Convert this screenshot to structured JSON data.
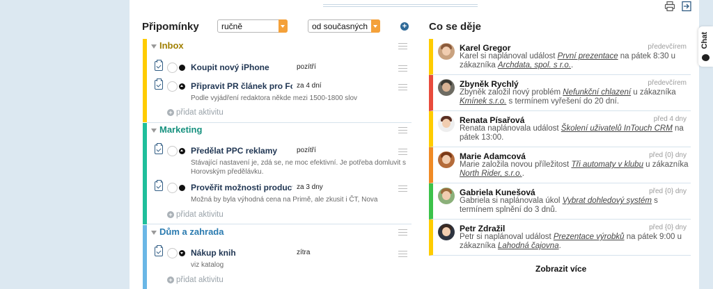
{
  "reminders": {
    "title": "Připomínky",
    "sort_select": "ručně",
    "filter_select": "od současných",
    "add_label": "+",
    "add_activity_label": "přidat aktivitu",
    "groups": [
      {
        "name": "Inbox",
        "color": "#ffcc00",
        "name_color": "#a07f00",
        "tasks": [
          {
            "name": "Koupit nový iPhone",
            "due": "pozítří",
            "desc": ""
          },
          {
            "name": "Připravit PR článek pro Food",
            "due": "za 4 dní",
            "desc": "Podle vyjádření redaktora někde mezi 1500-1800 slov"
          }
        ]
      },
      {
        "name": "Marketing",
        "color": "#1fbf9b",
        "name_color": "#17917f",
        "tasks": [
          {
            "name": "Předělat PPC reklamy",
            "due": "pozítří",
            "desc": "Stávající nastavení je, zdá se, ne moc efektivní. Je potřeba domluvit s Horovským předělávku."
          },
          {
            "name": "Prověřit možnosti product placementu",
            "due": "za 3 dny",
            "desc": "Možná by byla výhodná cena na Primě, ale zkusit i ČT, Nova"
          }
        ]
      },
      {
        "name": "Dům a zahrada",
        "color": "#6ab7e6",
        "name_color": "#2b7bb0",
        "tasks": [
          {
            "name": "Nákup knih",
            "due": "zítra",
            "desc": "viz katalog"
          }
        ]
      }
    ]
  },
  "feed": {
    "title": "Co se děje",
    "more_label": "Zobrazit více",
    "items": [
      {
        "color": "#ffcc00",
        "who": "Karel Gregor",
        "when": "předevčírem",
        "m1": "Karel si naplánoval událost ",
        "link1": "První prezentace",
        "m2": " na pátek 8:30 u zákazníka ",
        "link2": "Archdata, spol. s r.o.",
        "m3": "."
      },
      {
        "color": "#e84b3c",
        "who": "Zbyněk Rychlý",
        "when": "předevčírem",
        "m1": "Zbyněk založil nový problém ",
        "link1": "Nefunkční chlazení",
        "m2": " u zákazníka ",
        "link2": "Kmínek s.r.o.",
        "m3": " s termínem vyřešení do 20 dní."
      },
      {
        "color": "#ffcc00",
        "who": "Renata Písařová",
        "when": "před 4 dny",
        "m1": "Renata naplánovala událost ",
        "link1": "Školení uživatelů InTouch CRM",
        "m2": " na pátek 13:00.",
        "link2": "",
        "m3": ""
      },
      {
        "color": "#f08a24",
        "who": "Marie Adamcová",
        "when": "před {0} dny",
        "m1": "Marie založila novou příležitost ",
        "link1": "Tři automaty v klubu",
        "m2": " u zákazníka ",
        "link2": "North Rider, s.r.o.",
        "m3": "."
      },
      {
        "color": "#3cc24a",
        "who": "Gabriela Kunešová",
        "when": "před {0} dny",
        "m1": "Gabriela si naplánovala úkol ",
        "link1": "Vybrat dohledový systém",
        "m2": " s termínem splnění do 3 dnů.",
        "link2": "",
        "m3": ""
      },
      {
        "color": "#ffcc00",
        "who": "Petr Zdražil",
        "when": "před {0} dny",
        "m1": "Petr si naplánoval událost ",
        "link1": "Prezentace výrobků",
        "m2": " na pátek 9:00 u zákazníka ",
        "link2": "Lahodná čajovna",
        "m3": "."
      }
    ]
  },
  "chat_label": "Chat",
  "icons": [
    "print-icon",
    "logout-icon",
    "clipboard-check-icon",
    "priority-dot-icon",
    "menu-icon",
    "chat-bubble-icon"
  ]
}
